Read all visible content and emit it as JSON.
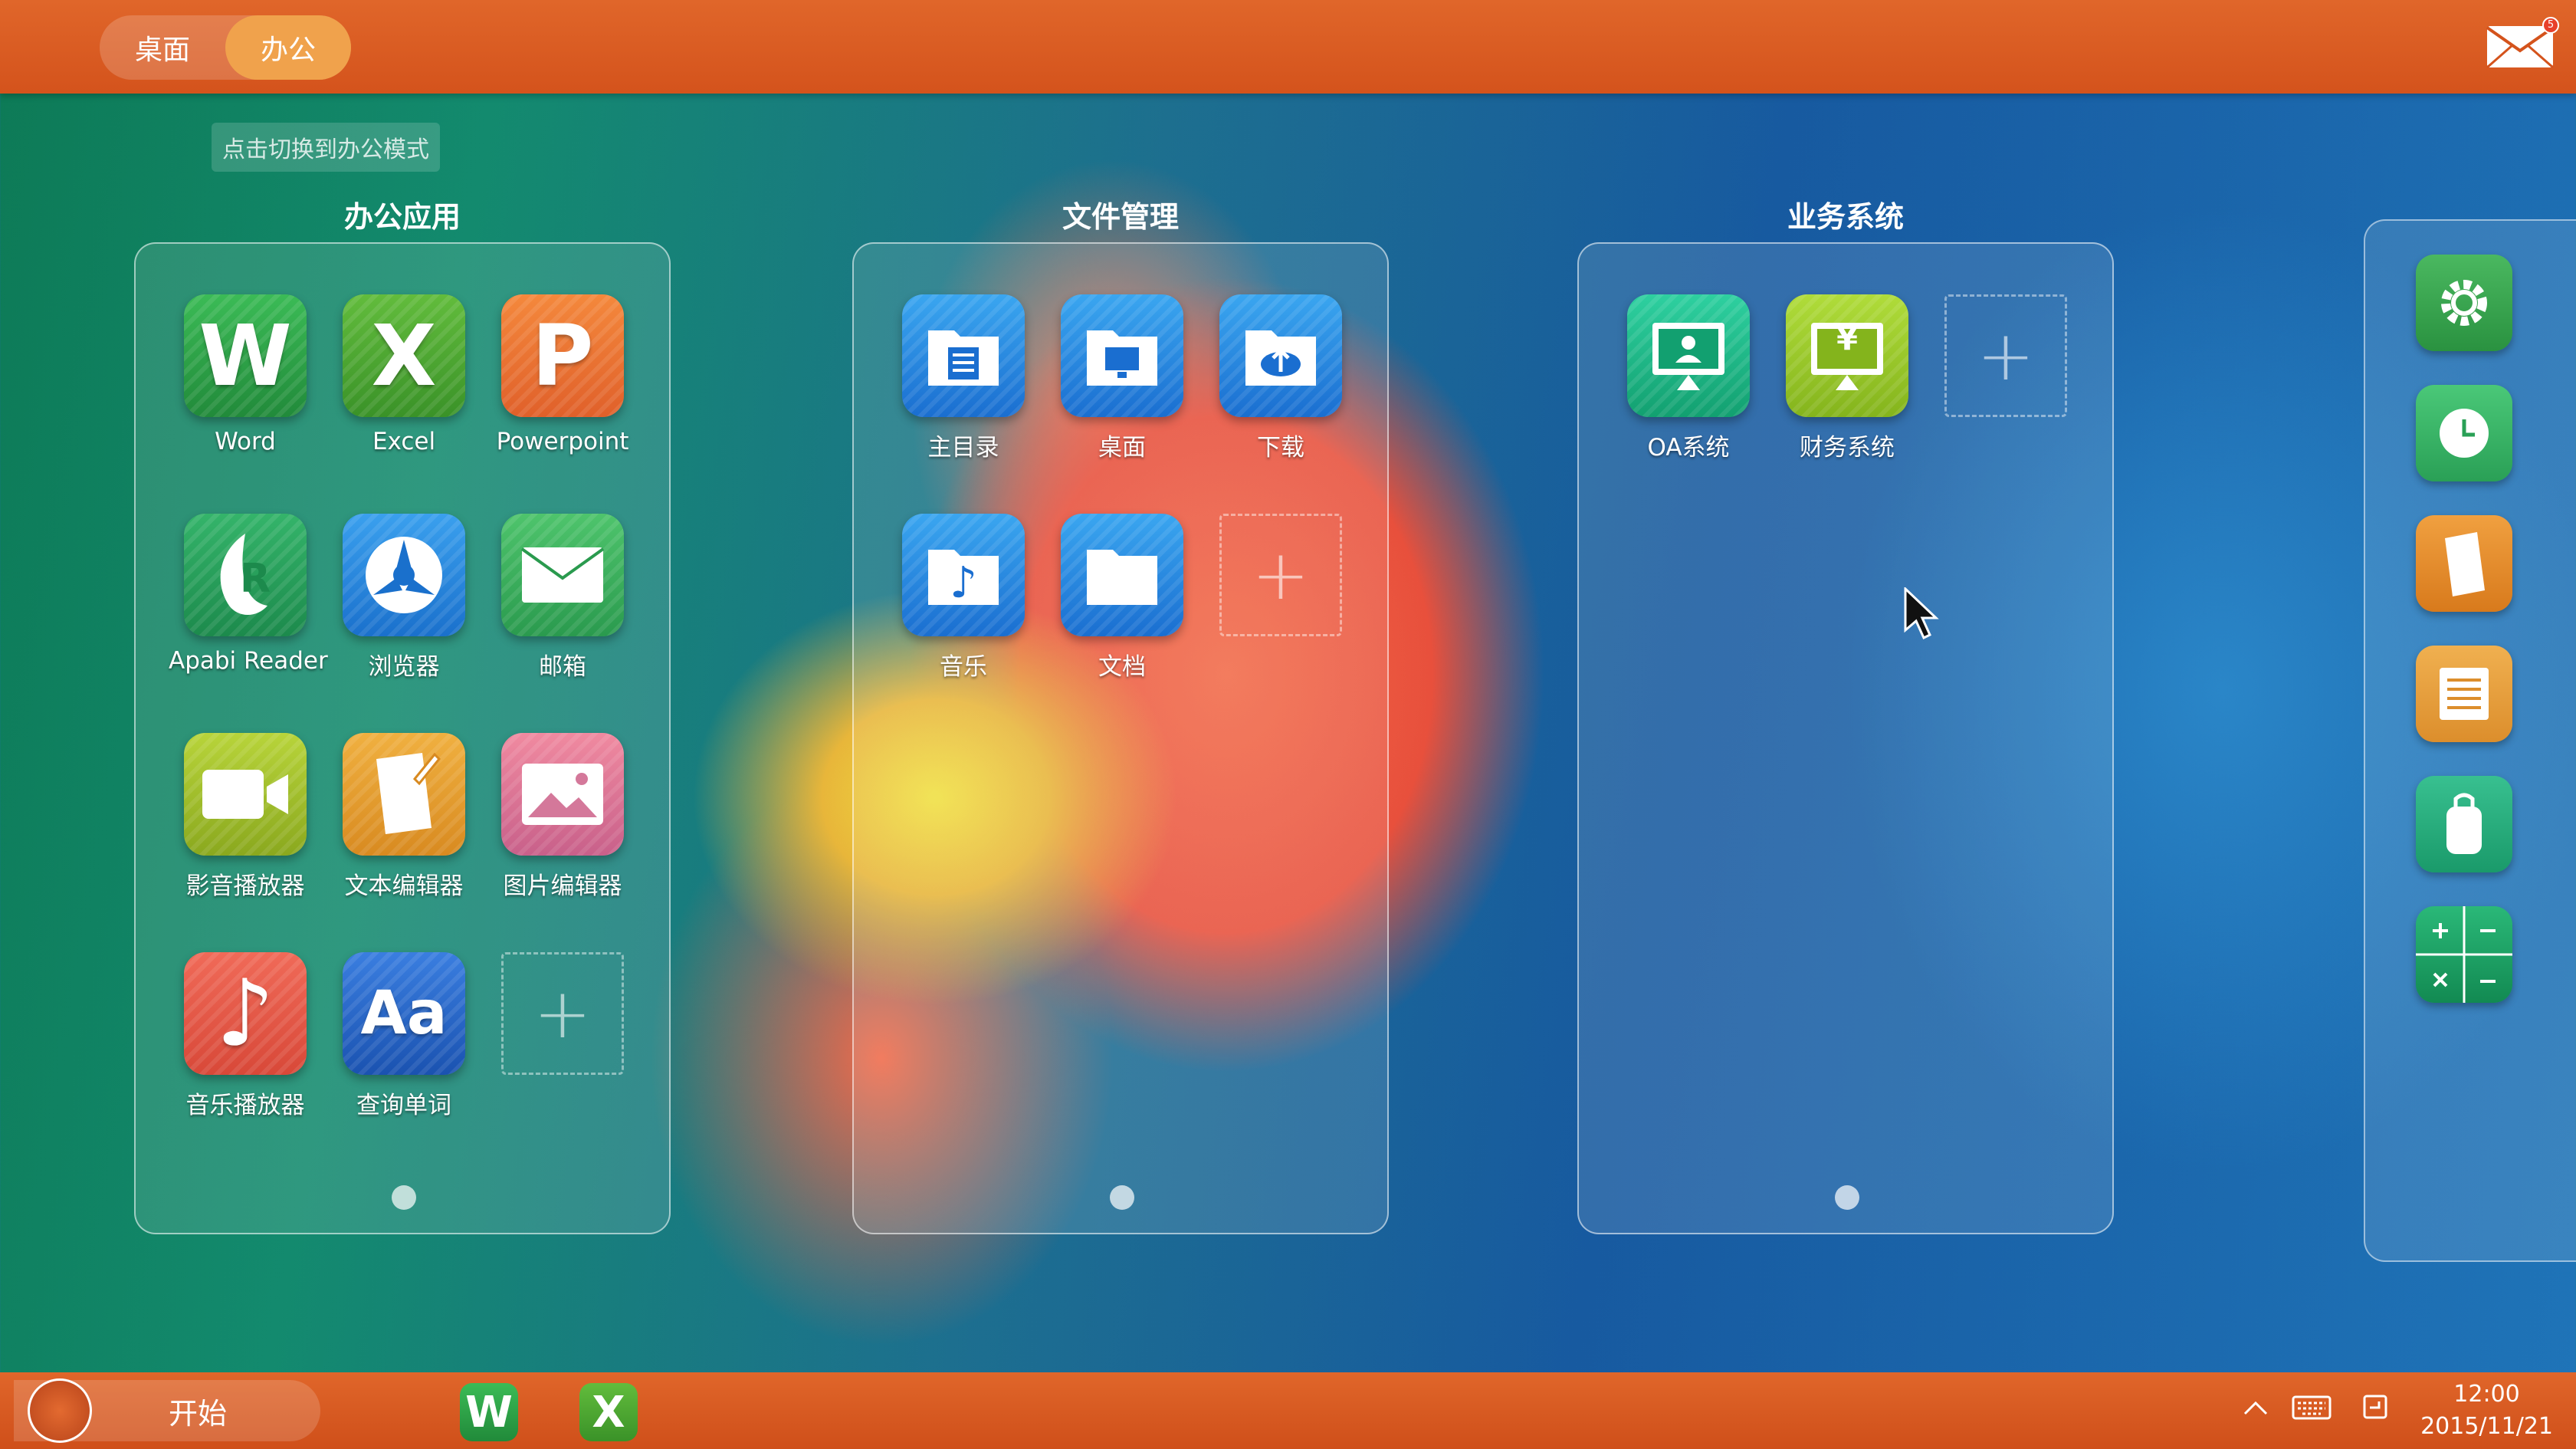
{
  "topbar": {
    "modes": [
      "桌面",
      "办公"
    ],
    "active_mode": "办公",
    "mail_badge": "5"
  },
  "tooltip": "点击切换到办公模式",
  "panels": [
    {
      "title": "办公应用",
      "items": [
        {
          "label": "Word",
          "icon": "word-icon",
          "glyph": "W",
          "color": "#2fa84a"
        },
        {
          "label": "Excel",
          "icon": "excel-icon",
          "glyph": "X",
          "color": "#4fae3a"
        },
        {
          "label": "Powerpoint",
          "icon": "powerpoint-icon",
          "glyph": "P",
          "color": "#f07a32"
        },
        {
          "label": "Apabi Reader",
          "icon": "apabi-reader-icon",
          "glyph": "R",
          "color": "#28a25e"
        },
        {
          "label": "浏览器",
          "icon": "browser-icon",
          "glyph": "",
          "color": "#2a8ee0"
        },
        {
          "label": "邮箱",
          "icon": "mail-icon",
          "glyph": "",
          "color": "#3ab860"
        },
        {
          "label": "影音播放器",
          "icon": "video-player-icon",
          "glyph": "",
          "color": "#a8c828"
        },
        {
          "label": "文本编辑器",
          "icon": "text-editor-icon",
          "glyph": "",
          "color": "#e8a030"
        },
        {
          "label": "图片编辑器",
          "icon": "image-editor-icon",
          "glyph": "",
          "color": "#e07a9a"
        },
        {
          "label": "音乐播放器",
          "icon": "music-player-icon",
          "glyph": "♪",
          "color": "#e85a48"
        },
        {
          "label": "查询单词",
          "icon": "dictionary-icon",
          "glyph": "Aa",
          "color": "#2a68c8"
        }
      ]
    },
    {
      "title": "文件管理",
      "items": [
        {
          "label": "主目录",
          "icon": "home-folder-icon",
          "glyph": "",
          "color": "#2a88e0"
        },
        {
          "label": "桌面",
          "icon": "desktop-folder-icon",
          "glyph": "",
          "color": "#2a88e0"
        },
        {
          "label": "下载",
          "icon": "download-folder-icon",
          "glyph": "",
          "color": "#2a88e0"
        },
        {
          "label": "音乐",
          "icon": "music-folder-icon",
          "glyph": "♪",
          "color": "#2a88e0"
        },
        {
          "label": "文档",
          "icon": "documents-folder-icon",
          "glyph": "",
          "color": "#2a88e0"
        }
      ]
    },
    {
      "title": "业务系统",
      "items": [
        {
          "label": "OA系统",
          "icon": "oa-system-icon",
          "glyph": "",
          "color": "#1ebc88"
        },
        {
          "label": "财务系统",
          "icon": "finance-system-icon",
          "glyph": "¥",
          "color": "#9ccc2a"
        }
      ]
    }
  ],
  "sidebar": [
    {
      "icon": "settings-icon",
      "color": "#3aa858"
    },
    {
      "icon": "clock-icon",
      "color": "#3ab868"
    },
    {
      "icon": "notes-icon",
      "color": "#e8902a"
    },
    {
      "icon": "list-icon",
      "color": "#e8a040"
    },
    {
      "icon": "backpack-icon",
      "color": "#2ab080"
    },
    {
      "icon": "calculator-icon",
      "color": "#1aa868"
    }
  ],
  "taskbar": {
    "start_label": "开始",
    "apps": [
      {
        "icon": "word-taskbar-icon",
        "glyph": "W"
      },
      {
        "icon": "excel-taskbar-icon",
        "glyph": "X"
      }
    ],
    "time": "12:00",
    "date": "2015/11/21"
  }
}
